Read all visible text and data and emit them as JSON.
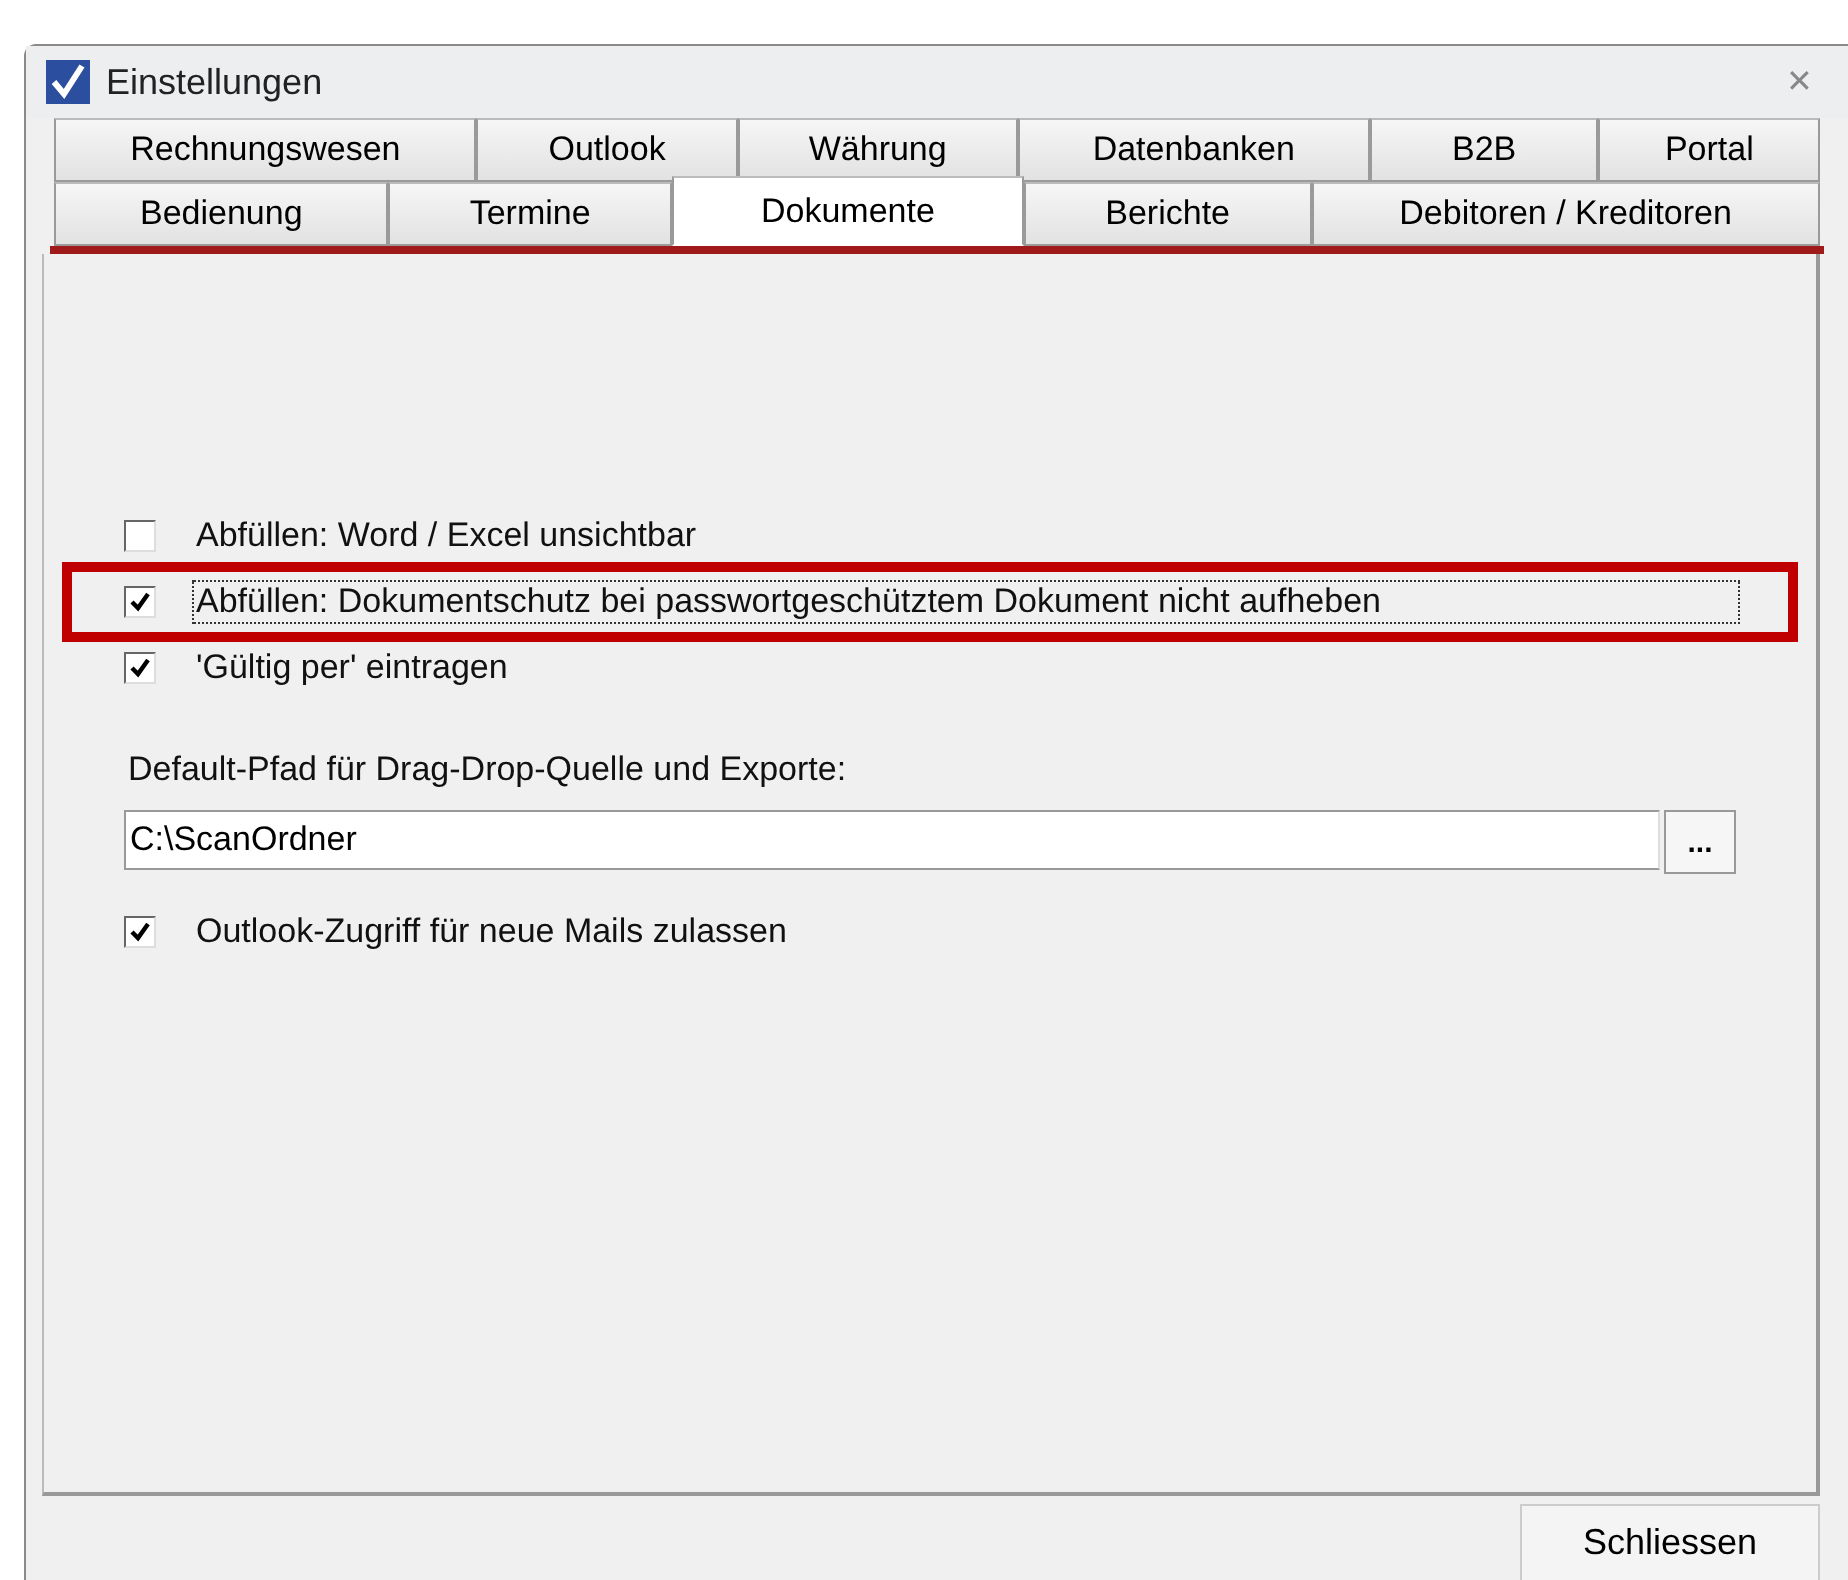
{
  "window": {
    "title": "Einstellungen",
    "close": "✕"
  },
  "tab_rows": [
    [
      {
        "label": "Rechnungswesen",
        "selected": false
      },
      {
        "label": "Outlook",
        "selected": false
      },
      {
        "label": "Währung",
        "selected": false
      },
      {
        "label": "Datenbanken",
        "selected": false
      },
      {
        "label": "B2B",
        "selected": false
      },
      {
        "label": "Portal",
        "selected": false
      }
    ],
    [
      {
        "label": "Bedienung",
        "selected": false
      },
      {
        "label": "Termine",
        "selected": false
      },
      {
        "label": "Dokumente",
        "selected": true
      },
      {
        "label": "Berichte",
        "selected": false
      },
      {
        "label": "Debitoren / Kreditoren",
        "selected": false
      }
    ]
  ],
  "options": [
    {
      "label": "Abfüllen: Word / Excel unsichtbar",
      "checked": false,
      "focused": false,
      "highlighted": false
    },
    {
      "label": "Abfüllen: Dokumentschutz bei passwortgeschütztem Dokument nicht aufheben",
      "checked": true,
      "focused": true,
      "highlighted": true
    },
    {
      "label": "'Gültig per' eintragen",
      "checked": true,
      "focused": false,
      "highlighted": false
    }
  ],
  "path": {
    "label": "Default-Pfad für Drag-Drop-Quelle und Exporte:",
    "value": "C:\\ScanOrdner",
    "browse": "..."
  },
  "outlook_option": {
    "label": "Outlook-Zugriff für neue Mails zulassen",
    "checked": true
  },
  "buttons": [
    "Schliessen"
  ]
}
